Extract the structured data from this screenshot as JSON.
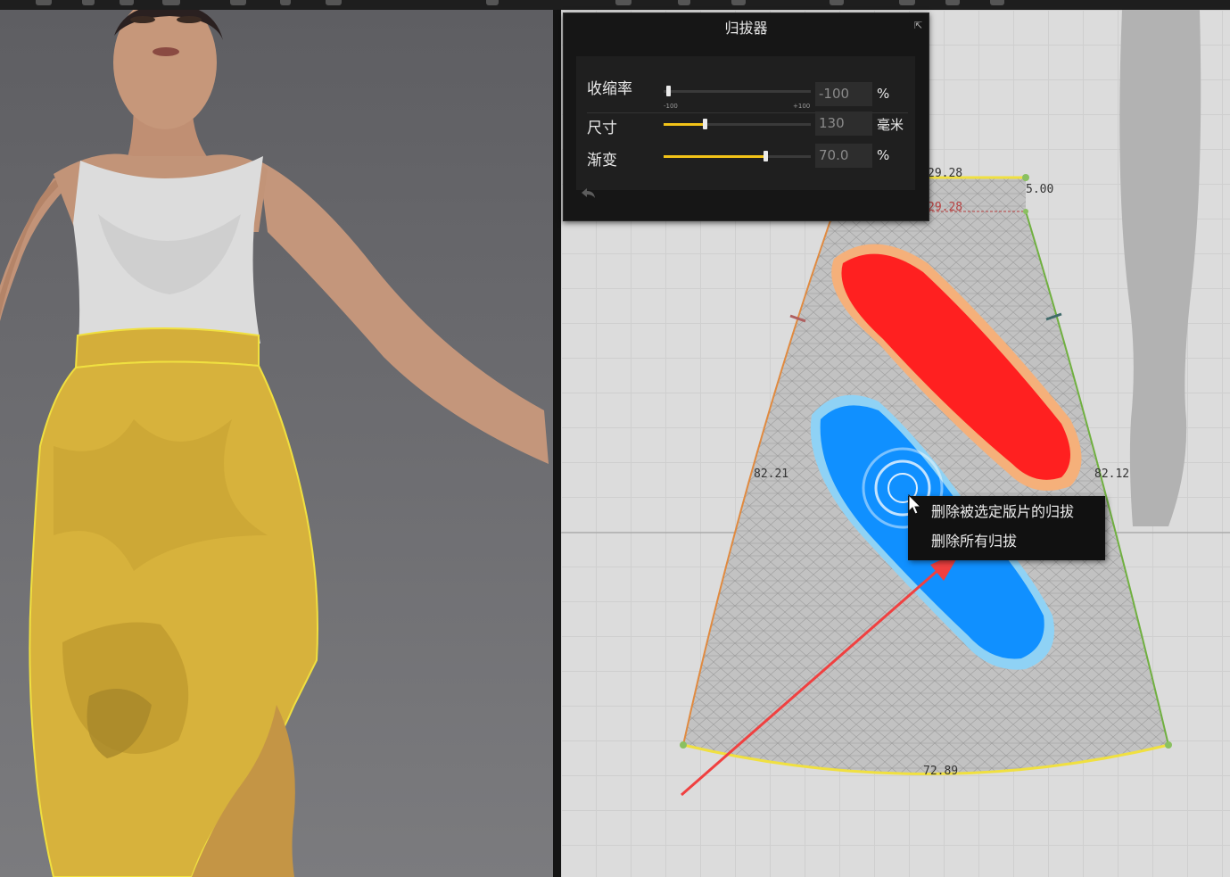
{
  "panel": {
    "title": "归拔器",
    "pin_icon": "pin-icon",
    "rows": [
      {
        "label": "收缩率",
        "value": "-100",
        "unit": "%",
        "slider_level_percent": 0,
        "tick_min": "-100",
        "tick_max": "+100"
      },
      {
        "label": "尺寸",
        "value": "130",
        "unit": "毫米",
        "slider_level_percent": 28
      },
      {
        "label": "渐变",
        "value": "70.0",
        "unit": "%",
        "slider_level_percent": 70
      }
    ],
    "undo_icon": "undo-arrow-icon"
  },
  "measurements": {
    "top_width": "29.28",
    "top_width_inner": "29.28",
    "corner": "5.00",
    "left_side": "82.21",
    "right_side": "82.12",
    "bottom_width": "72.89"
  },
  "context_menu": {
    "items": [
      "删除被选定版片的归拔",
      "删除所有归拔"
    ]
  },
  "colors": {
    "slider_fill": "#f2c318",
    "shrink_red": "#ff2020",
    "stretch_blue": "#1090ff",
    "pattern_outline": "#f0e040",
    "annotation_arrow": "#f04040",
    "skirt": "#d7b23c"
  }
}
